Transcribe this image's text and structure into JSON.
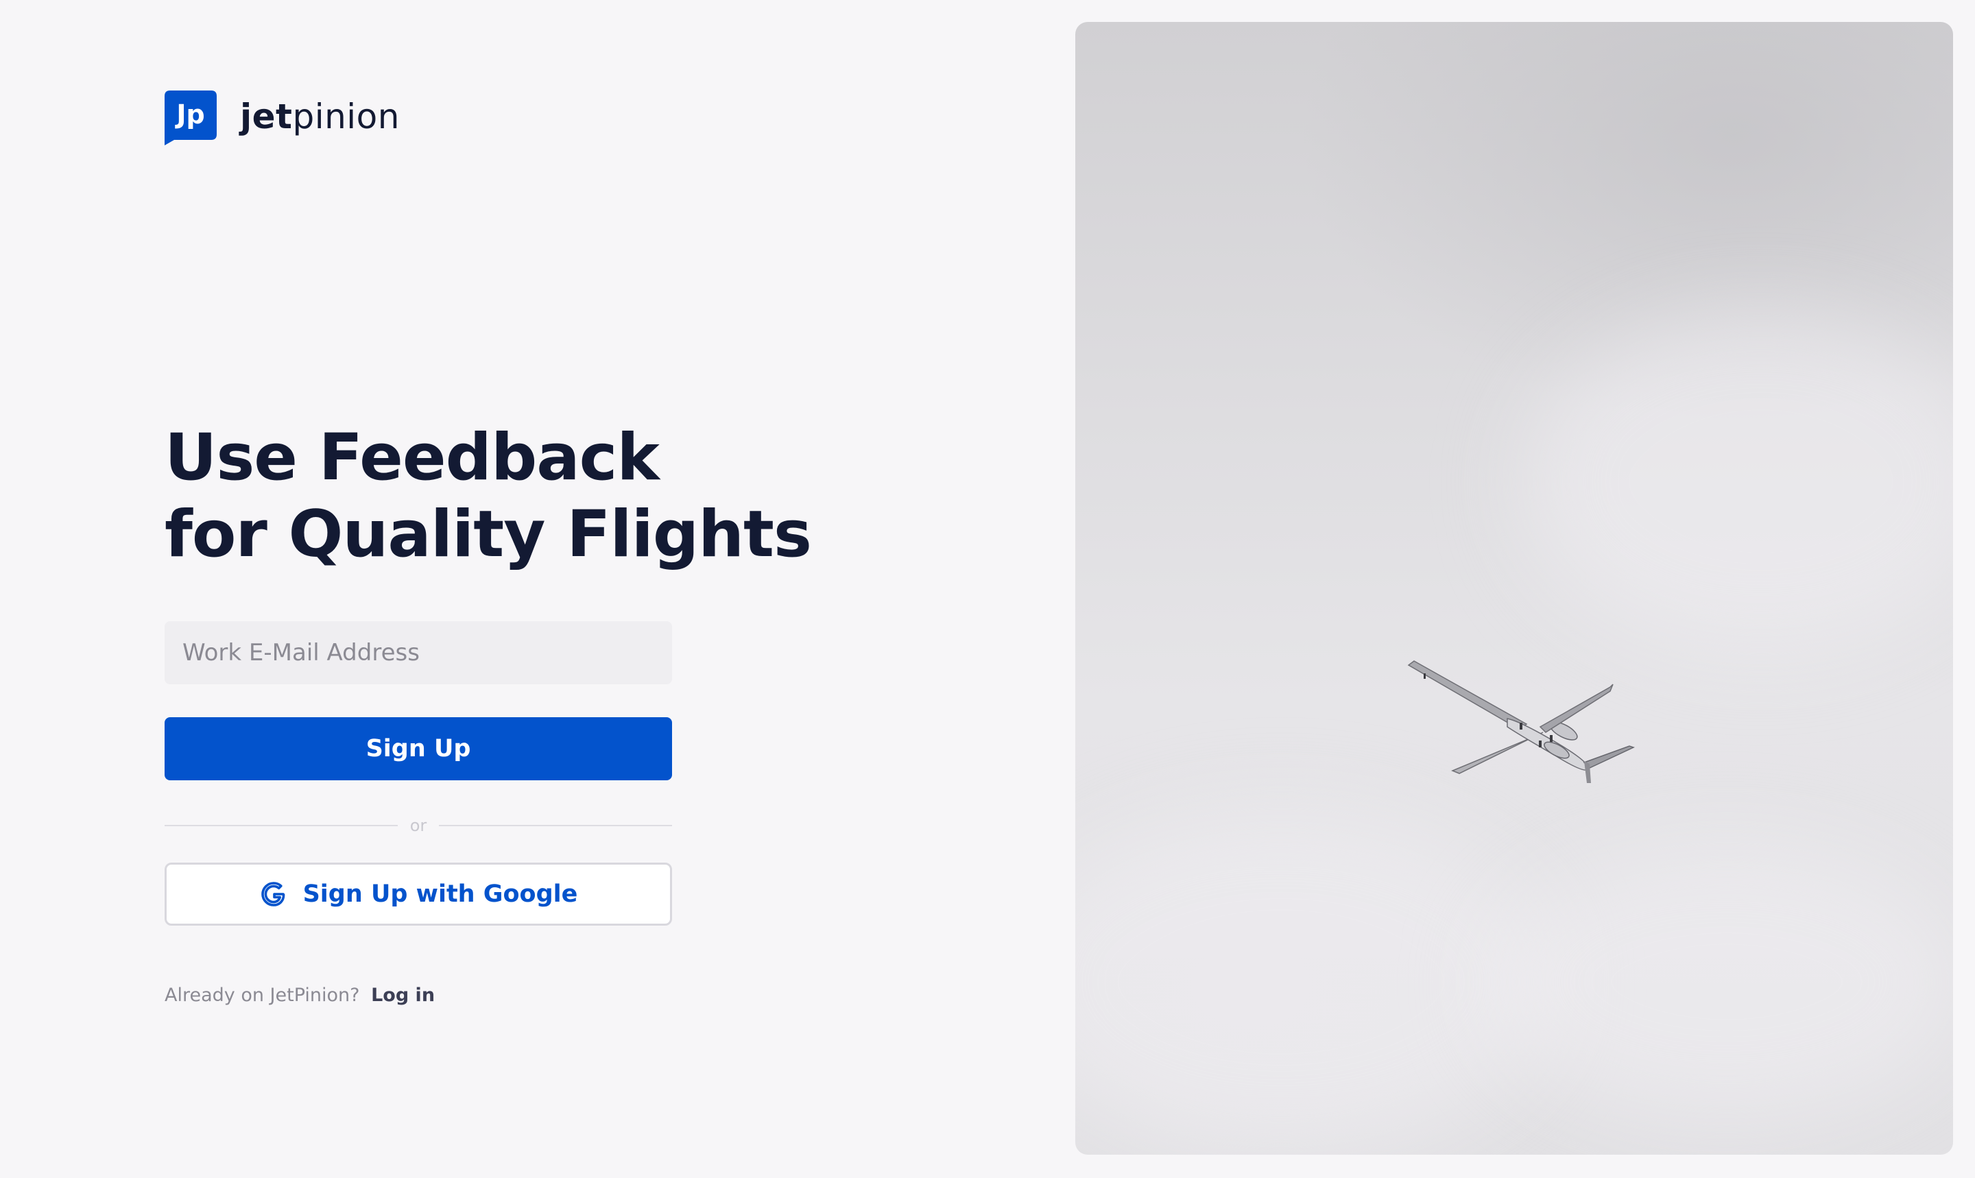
{
  "brand": {
    "name_bold": "jet",
    "name_light": "pinion",
    "logo_text": "Jp",
    "color": "#0353cc"
  },
  "headline": {
    "line1": "Use Feedback",
    "line2": "for Quality Flights"
  },
  "form": {
    "email_placeholder": "Work E-Mail Address",
    "email_value": "",
    "signup_label": "Sign Up",
    "divider_label": "or",
    "google_label": "Sign Up with Google"
  },
  "footer": {
    "prompt": "Already on JetPinion?",
    "login_label": "Log in"
  },
  "icons": {
    "logo": "jetpinion-logo-icon",
    "google": "google-icon"
  },
  "colors": {
    "primary": "#0353cc",
    "heading": "#131a33",
    "background": "#f7f6f8"
  }
}
